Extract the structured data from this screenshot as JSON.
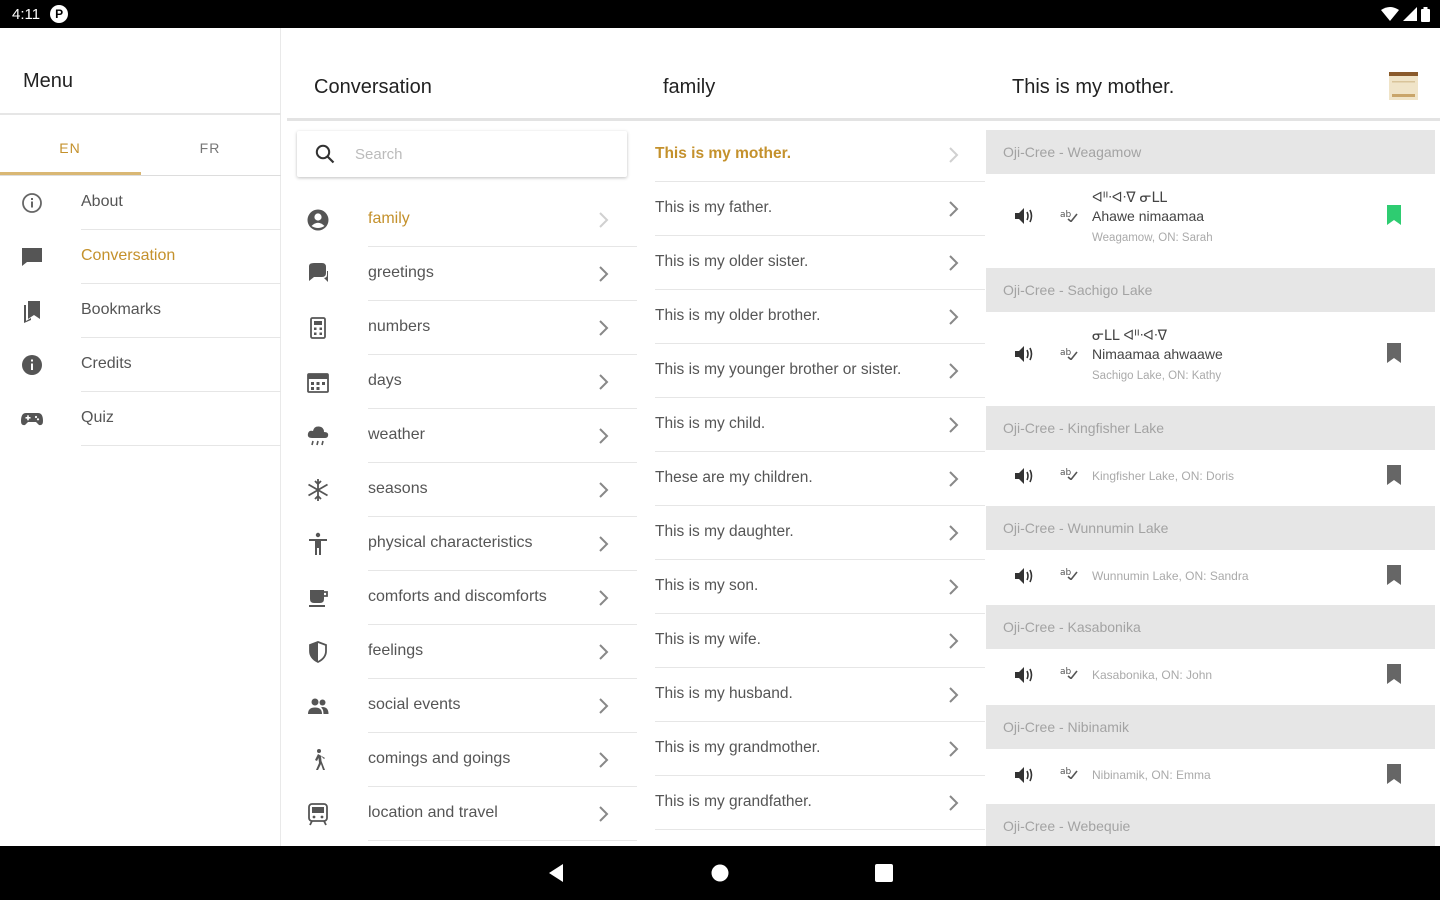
{
  "status_bar": {
    "time": "4:11",
    "notification_icon": "P"
  },
  "menu": {
    "title": "Menu",
    "lang_tabs": [
      {
        "label": "EN",
        "active": true
      },
      {
        "label": "FR",
        "active": false
      }
    ],
    "items": [
      {
        "label": "About",
        "icon": "info-outline-icon",
        "active": false
      },
      {
        "label": "Conversation",
        "icon": "chat-icon",
        "active": true
      },
      {
        "label": "Bookmarks",
        "icon": "bookmarks-icon",
        "active": false
      },
      {
        "label": "Credits",
        "icon": "info-filled-icon",
        "active": false
      },
      {
        "label": "Quiz",
        "icon": "gamepad-icon",
        "active": false
      }
    ]
  },
  "categories": {
    "title": "Conversation",
    "search_placeholder": "Search",
    "search_value": "",
    "items": [
      {
        "label": "family",
        "icon": "person-circle-icon",
        "active": true
      },
      {
        "label": "greetings",
        "icon": "chat-bubbles-icon",
        "active": false
      },
      {
        "label": "numbers",
        "icon": "calculator-icon",
        "active": false
      },
      {
        "label": "days",
        "icon": "calendar-icon",
        "active": false
      },
      {
        "label": "weather",
        "icon": "rain-cloud-icon",
        "active": false
      },
      {
        "label": "seasons",
        "icon": "snowflake-icon",
        "active": false
      },
      {
        "label": "physical characteristics",
        "icon": "accessibility-icon",
        "active": false
      },
      {
        "label": "comforts and discomforts",
        "icon": "coffee-icon",
        "active": false
      },
      {
        "label": "feelings",
        "icon": "shield-half-icon",
        "active": false
      },
      {
        "label": "social events",
        "icon": "people-icon",
        "active": false
      },
      {
        "label": "comings and goings",
        "icon": "walking-icon",
        "active": false
      },
      {
        "label": "location and travel",
        "icon": "train-icon",
        "active": false
      }
    ]
  },
  "phrases": {
    "title": "family",
    "items": [
      {
        "label": "This is my mother.",
        "active": true
      },
      {
        "label": "This is my father.",
        "active": false
      },
      {
        "label": "This is my older sister.",
        "active": false
      },
      {
        "label": "This is my older brother.",
        "active": false
      },
      {
        "label": "This is my younger brother or sister.",
        "active": false
      },
      {
        "label": "This is my child.",
        "active": false
      },
      {
        "label": "These are my children.",
        "active": false
      },
      {
        "label": "This is my daughter.",
        "active": false
      },
      {
        "label": "This is my son.",
        "active": false
      },
      {
        "label": "This is my wife.",
        "active": false
      },
      {
        "label": "This is my husband.",
        "active": false
      },
      {
        "label": "This is my grandmother.",
        "active": false
      },
      {
        "label": "This is my grandfather.",
        "active": false
      }
    ]
  },
  "translations": {
    "title": "This is my mother.",
    "groups": [
      {
        "dialect": "Oji-Cree - Weagamow",
        "syllabics": "ᐊᐦᐧᐊᐧᐁ ᓂᒪᒪ",
        "roman": "Ahawe nimaamaa",
        "source": "Weagamow, ON: Sarah",
        "bookmarked": true
      },
      {
        "dialect": "Oji-Cree - Sachigo Lake",
        "syllabics": "ᓂᒪᒪ ᐊᐦᐧᐊᐧᐁ",
        "roman": "Nimaamaa ahwaawe",
        "source": "Sachigo Lake, ON: Kathy",
        "bookmarked": false
      },
      {
        "dialect": "Oji-Cree - Kingfisher Lake",
        "syllabics": "",
        "roman": "",
        "source": "Kingfisher Lake, ON: Doris",
        "bookmarked": false
      },
      {
        "dialect": "Oji-Cree - Wunnumin Lake",
        "syllabics": "",
        "roman": "",
        "source": "Wunnumin Lake, ON: Sandra",
        "bookmarked": false
      },
      {
        "dialect": "Oji-Cree - Kasabonika",
        "syllabics": "",
        "roman": "",
        "source": "Kasabonika, ON: John",
        "bookmarked": false
      },
      {
        "dialect": "Oji-Cree - Nibinamik",
        "syllabics": "",
        "roman": "",
        "source": "Nibinamik, ON: Emma",
        "bookmarked": false
      },
      {
        "dialect": "Oji-Cree - Webequie",
        "syllabics": "",
        "roman": "",
        "source": "",
        "bookmarked": false
      }
    ]
  },
  "colors": {
    "accent": "#c4912c",
    "accent_light": "#d9b774",
    "bookmark_active": "#2ecc71",
    "dialect_bg": "#e6e6e6"
  }
}
